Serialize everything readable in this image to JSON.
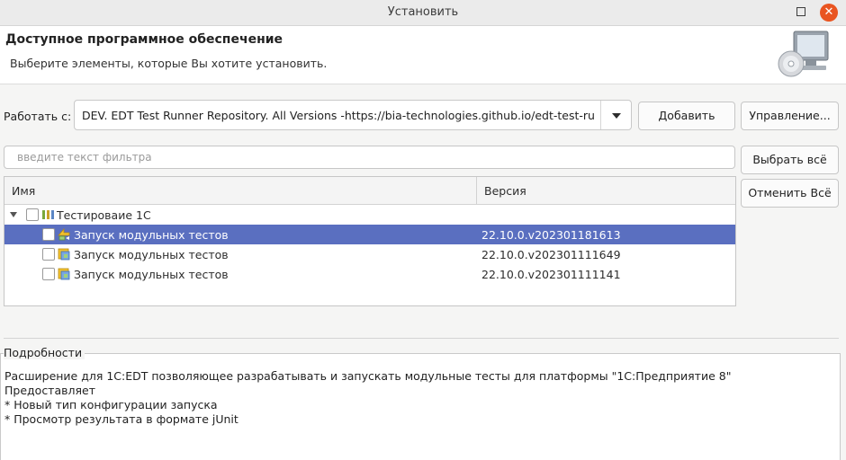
{
  "window": {
    "title": "Установить"
  },
  "header": {
    "title": "Доступное программное обеспечение",
    "subtitle": "Выберите элементы, которые Вы хотите установить.",
    "icon": "install-cd-monitor-icon"
  },
  "work_with": {
    "label": "Работать с:",
    "value": "DEV. EDT Test Runner Repository. All Versions -https://bia-technologies.github.io/edt-test-runr",
    "add_label": "Добавить",
    "manage_label": "Управление..."
  },
  "filter": {
    "placeholder": "введите текст фильтра",
    "value": ""
  },
  "buttons": {
    "select_all": "Выбрать всё",
    "deselect_all": "Отменить Всё"
  },
  "table": {
    "columns": [
      "Имя",
      "Версия"
    ],
    "category": {
      "name": "Тестироваие 1С",
      "expanded": true,
      "checked": false,
      "icon": "category-icon"
    },
    "items": [
      {
        "name": "Запуск модульных тестов",
        "version": "22.10.0.v202301181613",
        "selected": true,
        "checked": false,
        "icon": "update-feature-icon"
      },
      {
        "name": "Запуск модульных тестов",
        "version": "22.10.0.v202301111649",
        "selected": false,
        "checked": false,
        "icon": "feature-icon"
      },
      {
        "name": "Запуск модульных тестов",
        "version": "22.10.0.v202301111141",
        "selected": false,
        "checked": false,
        "icon": "feature-icon"
      }
    ]
  },
  "details": {
    "label": "Подробности",
    "lines": [
      "Расширение для 1С:EDT позволяющее разрабатывать и запускать модульные тесты для платформы \"1С:Предприятие 8\"",
      "Предоставляет",
      "* Новый тип конфигурации запуска",
      "* Просмотр результата в формате jUnit"
    ]
  },
  "colors": {
    "selection": "#5a6fc0",
    "close_button": "#e95420"
  }
}
